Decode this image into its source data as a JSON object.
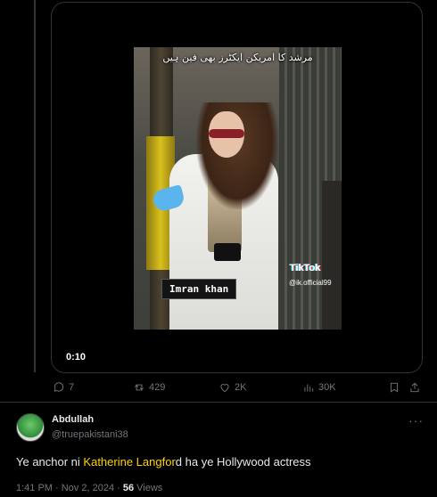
{
  "video": {
    "caption_urdu": "مرشد کا امریکن ایکٹرز بھی فین ہیں",
    "label": "Imran khan",
    "tiktok_logo": "TikTok",
    "tiktok_handle": "@ik.official99",
    "duration": "0:10"
  },
  "actions": {
    "replies": "7",
    "reposts": "429",
    "likes": "2K",
    "views": "30K"
  },
  "reply": {
    "author_name": "Abdullah",
    "author_handle": "@truepakistani38",
    "text_before": "Ye anchor ni ",
    "text_highlight": "Katherine Langfor",
    "text_after": "d ha ye Hollywood actress",
    "timestamp": "1:41 PM · Nov 2, 2024 · ",
    "views_count": "56",
    "views_label": " Views",
    "more_icon": "more-icon"
  }
}
